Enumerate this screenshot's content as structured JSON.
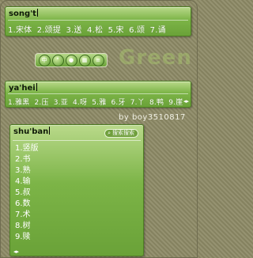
{
  "panel1": {
    "pinyin": "song't",
    "candidates": [
      "1.宋体",
      "2.颂提",
      "3.送",
      "4.松",
      "5.宋",
      "6.颂",
      "7.诵"
    ]
  },
  "toolbar": {
    "buttons": [
      {
        "icon": "chinese-mode-icon",
        "glyph": "中"
      },
      {
        "icon": "punctuation-icon",
        "glyph": "°"
      },
      {
        "icon": "full-width-icon",
        "glyph": "●"
      },
      {
        "icon": "soft-keyboard-icon",
        "glyph": "▦"
      },
      {
        "icon": "menu-icon",
        "glyph": "≡"
      }
    ]
  },
  "skin_name": "Green",
  "panel2": {
    "pinyin": "ya'hei",
    "candidates": [
      "1.雅黑",
      "2.压",
      "3.亚",
      "4.呀",
      "5.雅",
      "6.牙",
      "7.丫",
      "8.鸭",
      "9.崖"
    ]
  },
  "credit": "by boy3510817",
  "panel3": {
    "pinyin": "shu'ban",
    "search_label": "搜索搜索",
    "candidates": [
      "1.竖版",
      "2.书",
      "3.熟",
      "4.输",
      "5.叔",
      "6.数",
      "7.术",
      "8.树",
      "9.赎"
    ]
  },
  "colors": {
    "background": "#8d8a66",
    "panel_green": "#7cb447",
    "candidate_text": "#ffffff"
  }
}
